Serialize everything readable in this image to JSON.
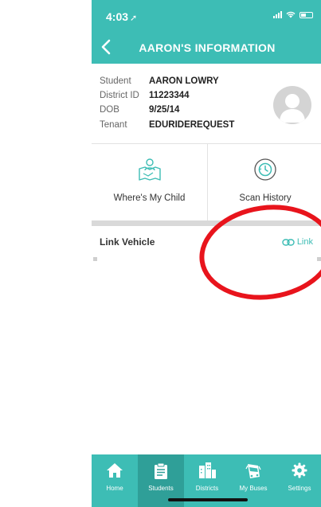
{
  "status_bar": {
    "time": "4:03"
  },
  "nav": {
    "title": "AARON'S INFORMATION"
  },
  "student_info": {
    "rows": [
      {
        "label": "Student",
        "value": "AARON LOWRY"
      },
      {
        "label": "District ID",
        "value": "11223344"
      },
      {
        "label": "DOB",
        "value": "9/25/14"
      },
      {
        "label": "Tenant",
        "value": "EDURIDEREQUEST"
      }
    ]
  },
  "tiles": [
    {
      "label": "Where's My Child",
      "icon": "map-person-icon"
    },
    {
      "label": "Scan History",
      "icon": "history-clock-icon"
    }
  ],
  "link_vehicle": {
    "title": "Link Vehicle",
    "button_label": "Link"
  },
  "tab_bar": {
    "active": "Students",
    "items": [
      {
        "label": "Home",
        "icon": "home-icon"
      },
      {
        "label": "Students",
        "icon": "clipboard-icon"
      },
      {
        "label": "Districts",
        "icon": "buildings-icon"
      },
      {
        "label": "My Buses",
        "icon": "bus-icon"
      },
      {
        "label": "Settings",
        "icon": "gear-icon"
      }
    ]
  },
  "colors": {
    "accent": "#3dbdb5",
    "accent_dark": "#2f9f98",
    "annotation": "#e8141c"
  }
}
